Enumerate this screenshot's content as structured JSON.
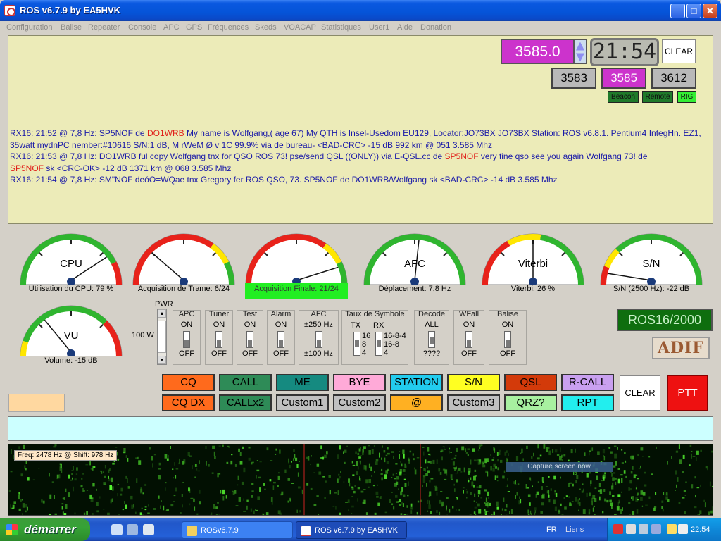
{
  "window": {
    "title": "ROS v6.7.9 by EA5HVK"
  },
  "menu": [
    "Configuration",
    "Balise",
    "Repeater",
    "Console",
    "APC",
    "GPS",
    "Fréquences",
    "Skeds",
    "VOACAP",
    "Statistiques",
    "User1",
    "Aide",
    "Donation"
  ],
  "rx": {
    "frequency": "3585.0",
    "clock": "21:54",
    "clear_label": "CLEAR",
    "freq_buttons": [
      "3583",
      "3585",
      "3612"
    ],
    "leds": [
      "Beacon",
      "Remote",
      "RIG"
    ],
    "lines": [
      {
        "prefix": "RX16: 21:52 @ 7,8 Hz:  SP5NOF de ",
        "red": "DO1WRB",
        "rest": " My name is Wolfgang,( age 67) My QTH is Insel-Usedom EU129, Locator:JO73BX JO73BX Station: ROS v6.8.1. Pentium4 IntegHn. EZ1, 35watt     mydnPC nember:#10616 S/N:1 dB, M rWeM Ø v  1C  99.9% via de bureau-  <BAD-CRC> -15 dB  992 km @ 051  3.585 Mhz"
      },
      {
        "prefix": "RX16: 21:53 @ 7,8 Hz:  DO1WRB ful copy Wolfgang tnx for QSO ROS 73! pse/send QSL ((ONLY)) via E-QSL.cc de ",
        "red": "SP5NOF",
        "rest": " very fine qso see you again Wolfgang 73! de "
      },
      {
        "prefix": "",
        "red": "SP5NOF",
        "rest": " sk  <CRC-OK> -12 dB  1371 km @ 068  3.585 Mhz"
      },
      {
        "prefix": "RX16: 21:54 @ 7,8 Hz:  SM\"NOF deóO=WQae tnx Gregory fer ROS QSO, 73. SP5NOF de DO1WRB/Wolfgang sk  <BAD-CRC> -14 dB  3.585 Mhz",
        "red": "",
        "rest": ""
      }
    ]
  },
  "gauges": [
    {
      "name": "CPU",
      "label": "Utilisation du CPU: 79 %",
      "value": 0.79,
      "scheme": "cpu"
    },
    {
      "name": "",
      "label": "Acquisition de Trame: 6/24",
      "value": 0.25,
      "scheme": "red"
    },
    {
      "name": "",
      "label": "Acquisition Finale: 21/24",
      "value": 0.875,
      "scheme": "red",
      "highlight": true
    },
    {
      "name": "AFC",
      "label": "Déplacement: 7,8 Hz",
      "value": 0.53,
      "scheme": "green"
    },
    {
      "name": "Viterbi",
      "label": "Viterbi: 26 %",
      "value": 0.5,
      "scheme": "viterbi"
    },
    {
      "name": "S/N",
      "label": "S/N (2500 Hz): -22 dB",
      "value": 0.08,
      "scheme": "sn"
    },
    {
      "name": "VU",
      "label": "Volume: -15 dB",
      "value": 0.3,
      "scheme": "vu"
    }
  ],
  "power": {
    "label": "PWR",
    "value": "100 W"
  },
  "toggles": [
    {
      "title": "APC",
      "on": "ON",
      "off": "OFF",
      "state": "down"
    },
    {
      "title": "Tuner",
      "on": "ON",
      "off": "OFF",
      "state": "down"
    },
    {
      "title": "Test",
      "on": "ON",
      "off": "OFF",
      "state": "down"
    },
    {
      "title": "Alarm",
      "on": "ON",
      "off": "OFF",
      "state": "down"
    },
    {
      "title": "AFC",
      "on": "±250 Hz",
      "off": "±100 Hz",
      "state": "down"
    }
  ],
  "symbol_rate": {
    "title": "Taux de Symbole",
    "tx_label": "TX",
    "rx_label": "RX",
    "tx_opts": [
      "16",
      "8",
      "4"
    ],
    "rx_opts": [
      "16-8-4",
      "16-8",
      "4"
    ]
  },
  "toggles2": [
    {
      "title": "Decode",
      "on": "ALL",
      "off": "????",
      "state": "mid"
    },
    {
      "title": "WFall",
      "on": "ON",
      "off": "OFF",
      "state": "down"
    },
    {
      "title": "Balise",
      "on": "ON",
      "off": "OFF",
      "state": "down"
    }
  ],
  "status": {
    "mode": "ROS16/2000",
    "adif": "ADIF"
  },
  "macros_row1": [
    {
      "label": "CQ",
      "color": "#ff6a1c"
    },
    {
      "label": "CALL",
      "color": "#2e8b57"
    },
    {
      "label": "ME",
      "color": "#158a80"
    },
    {
      "label": "BYE",
      "color": "#ffaad8"
    },
    {
      "label": "STATION",
      "color": "#22ccee"
    },
    {
      "label": "S/N",
      "color": "#ffff22"
    },
    {
      "label": "QSL",
      "color": "#d33a0a"
    },
    {
      "label": "R-CALL",
      "color": "#c9a0f0"
    }
  ],
  "macros_row2": [
    {
      "label": "CQ DX",
      "color": "#ff6a1c"
    },
    {
      "label": "CALLx2",
      "color": "#2e8b57"
    },
    {
      "label": "Custom1",
      "color": "#c0c0c0"
    },
    {
      "label": "Custom2",
      "color": "#c0c0c0"
    },
    {
      "label": "@",
      "color": "#ffb022"
    },
    {
      "label": "Custom3",
      "color": "#c0c0c0"
    },
    {
      "label": "QRZ?",
      "color": "#a8f0a0"
    },
    {
      "label": "RPT",
      "color": "#22eeee"
    }
  ],
  "tx": {
    "clear_label": "CLEAR",
    "ptt_label": "PTT"
  },
  "waterfall": {
    "freq_info": "Freq: 2478 Hz @ Shift: 978 Hz",
    "capture": "Capture screen now"
  },
  "taskbar": {
    "start": "démarrer",
    "tasks": [
      "ROSv6.7.9",
      "ROS v6.7.9 by EA5HVK"
    ],
    "lang": "FR",
    "links": "Liens",
    "clock": "22:54"
  }
}
